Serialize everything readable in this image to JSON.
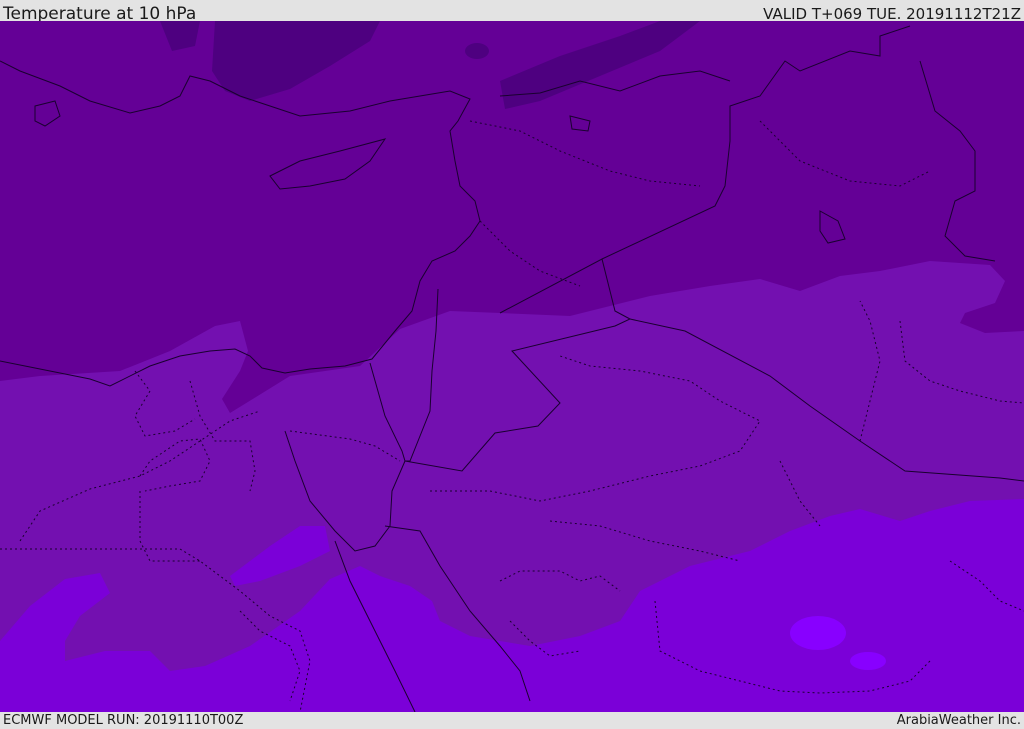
{
  "header": {
    "title": "Temperature at 10 hPa",
    "valid": "VALID T+069 TUE. 20191112T21Z"
  },
  "footer": {
    "model_run": "ECMWF MODEL RUN: 20191110T00Z",
    "credit": "ArabiaWeather Inc."
  },
  "map": {
    "field": "Temperature at 10 hPa",
    "colors": {
      "band_dark": "#4e0080",
      "band_1": "#640096",
      "band_2": "#7310b0",
      "band_3": "#7b00d8",
      "band_4": "#8800ff",
      "border_line": "#1a0030"
    }
  }
}
